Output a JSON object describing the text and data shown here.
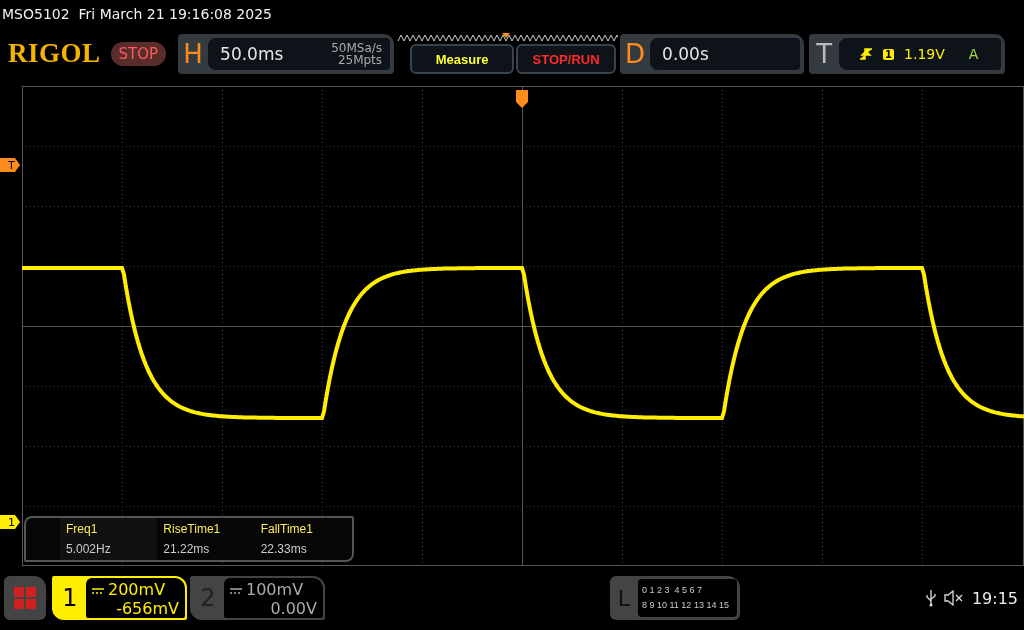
{
  "status_line": "MSO5102  Fri March 21 19:16:08 2025",
  "logo": "RIGOL",
  "run_state": "STOP",
  "horizontal": {
    "label": "H",
    "timebase": "50.0ms",
    "sample_rate": "50MSa/s",
    "memory_depth": "25Mpts"
  },
  "measure_button": "Measure",
  "stop_run_button": "STOP/RUN",
  "delay": {
    "label": "D",
    "value": "0.00s"
  },
  "trigger": {
    "label": "T",
    "source": "1",
    "level": "1.19V",
    "mode": "A"
  },
  "trigger_level_marker": "T",
  "channel_marker": "1",
  "measurements": [
    {
      "name": "Freq1",
      "value": "5.002Hz"
    },
    {
      "name": "RiseTime1",
      "value": "21.22ms"
    },
    {
      "name": "FallTime1",
      "value": "22.33ms"
    }
  ],
  "channels": [
    {
      "number": "1",
      "scale": "200mV",
      "offset": "-656mV",
      "selected": true
    },
    {
      "number": "2",
      "scale": "100mV",
      "offset": "0.00V",
      "selected": false
    }
  ],
  "logic": {
    "label": "L",
    "rows": [
      "0 1 2 3  4 5 6 7",
      "8 9 10 11 12 13 14 15"
    ]
  },
  "clock": "19:15"
}
